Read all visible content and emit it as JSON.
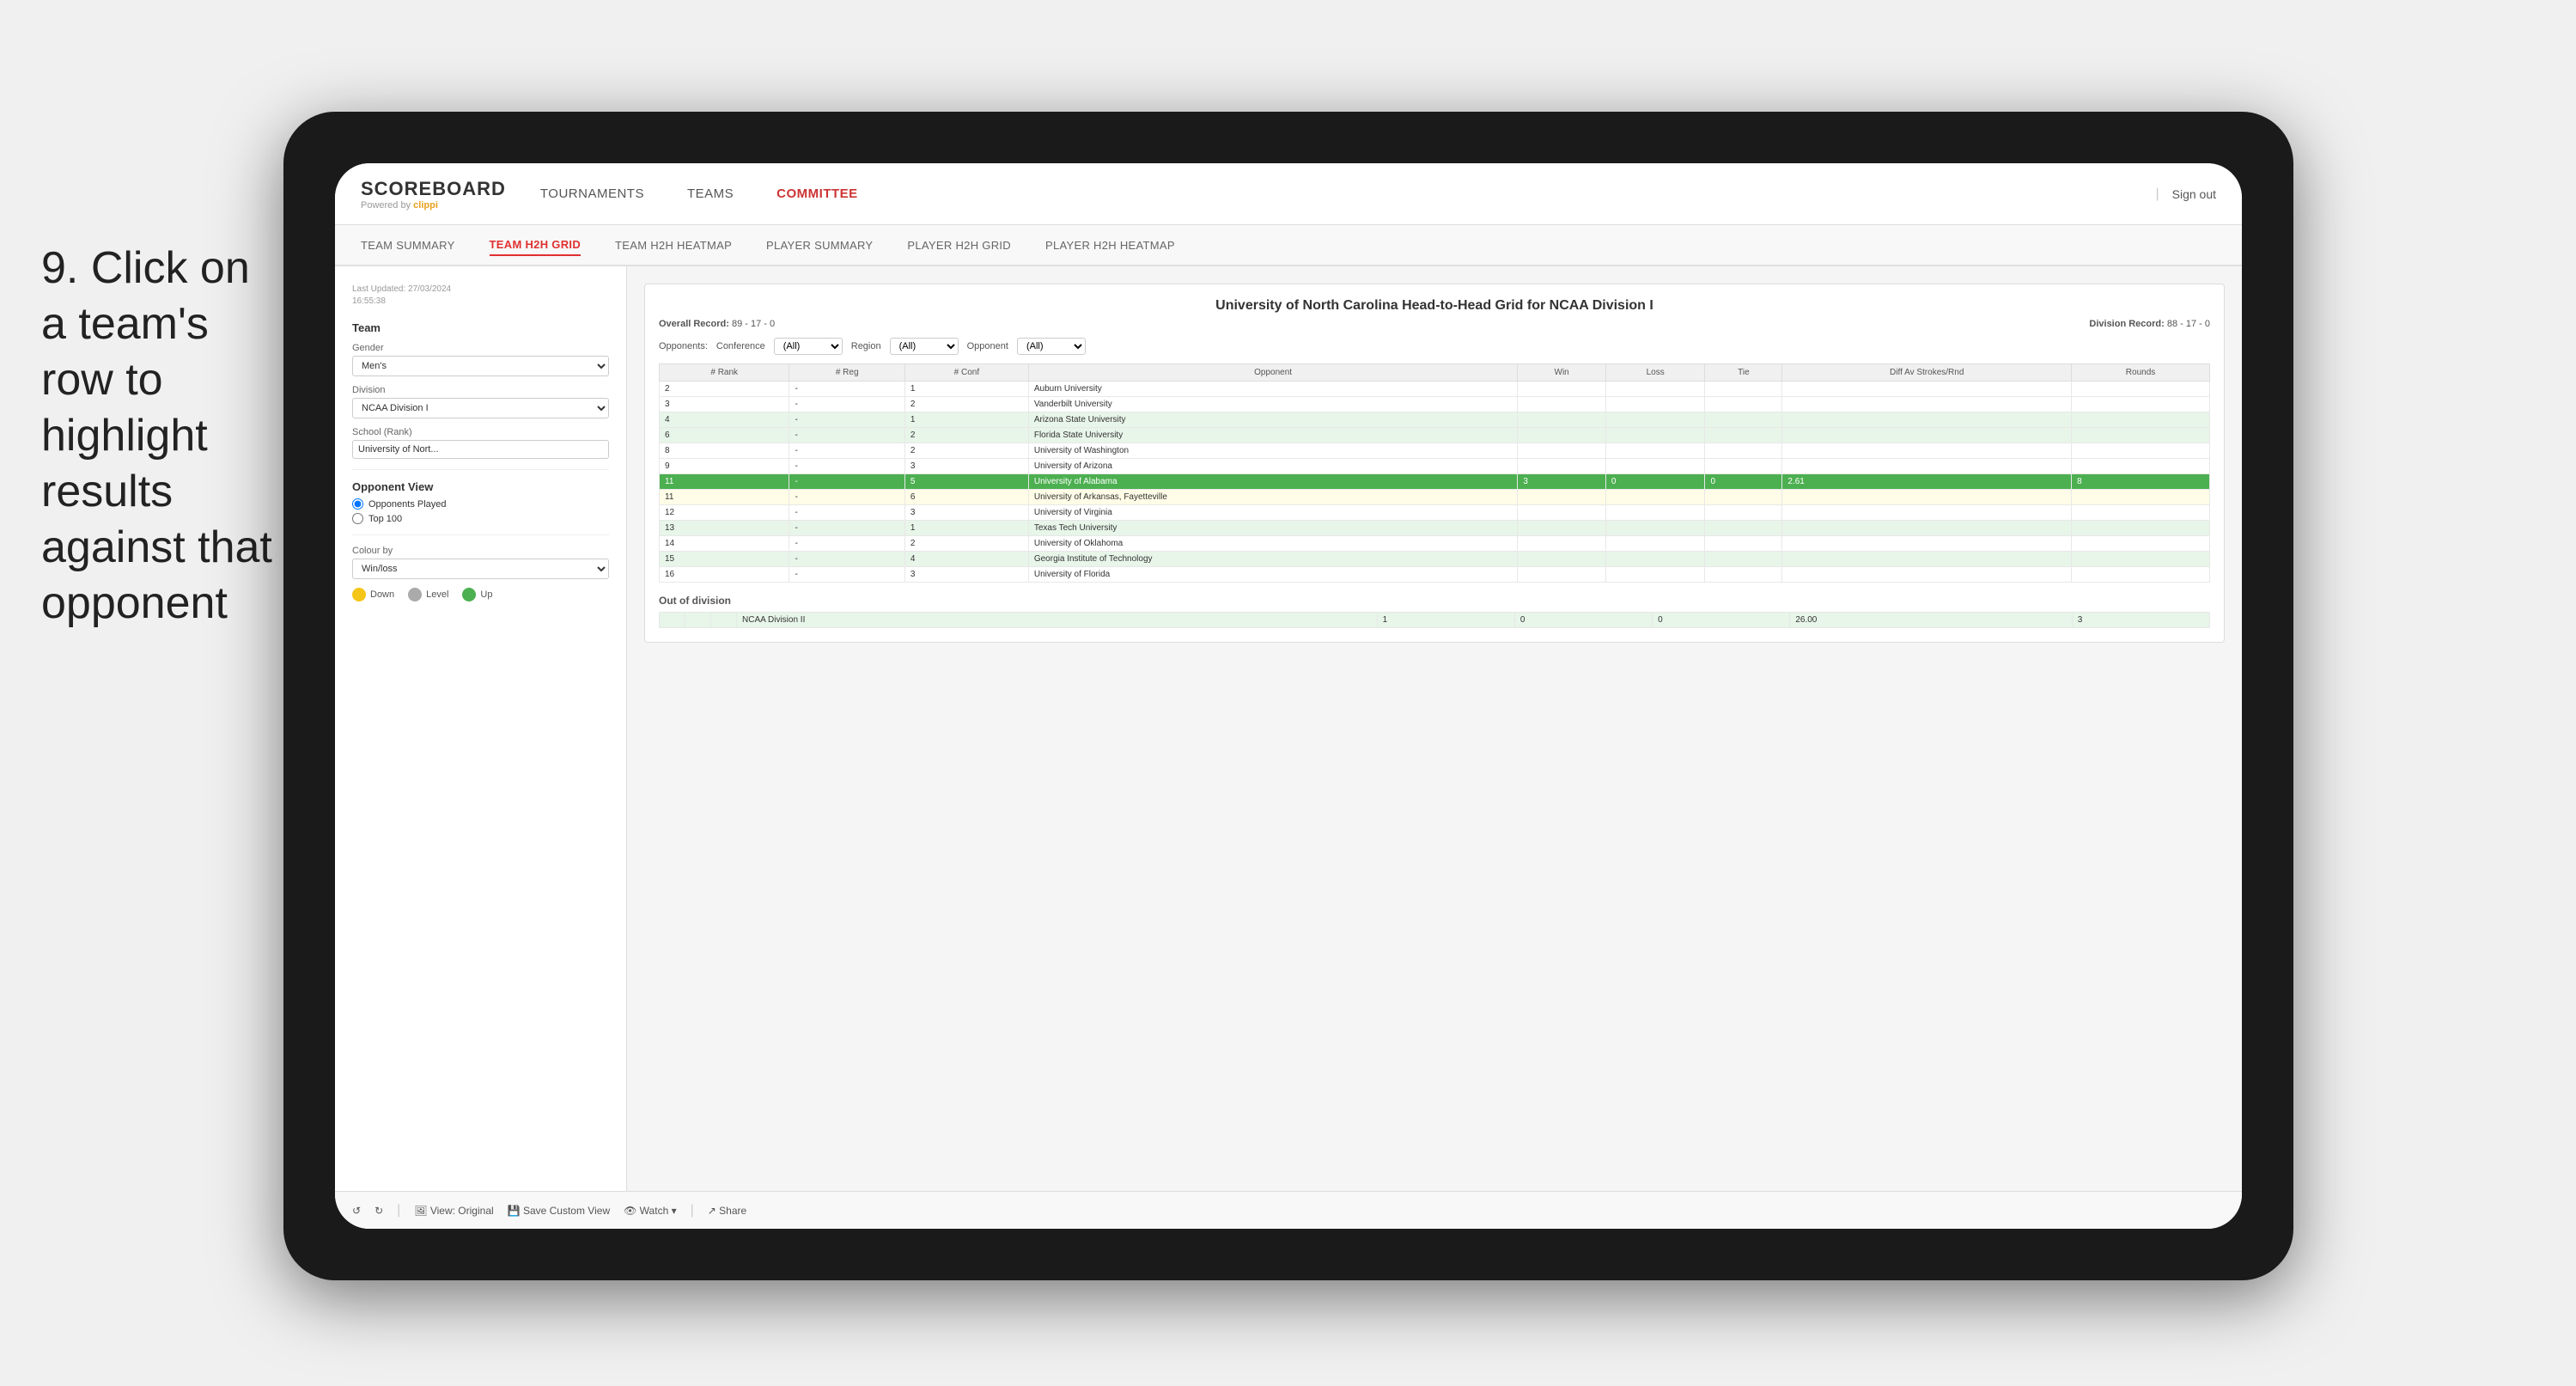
{
  "instruction": {
    "number": "9.",
    "text": "Click on a team's row to highlight results against that opponent"
  },
  "nav": {
    "logo": "SCOREBOARD",
    "powered_by": "Powered by",
    "brand": "clippi",
    "items": [
      "TOURNAMENTS",
      "TEAMS",
      "COMMITTEE"
    ],
    "sign_out": "Sign out"
  },
  "sub_nav": {
    "items": [
      "TEAM SUMMARY",
      "TEAM H2H GRID",
      "TEAM H2H HEATMAP",
      "PLAYER SUMMARY",
      "PLAYER H2H GRID",
      "PLAYER H2H HEATMAP"
    ],
    "active": "TEAM H2H GRID"
  },
  "left_panel": {
    "last_updated_label": "Last Updated: 27/03/2024",
    "last_updated_time": "16:55:38",
    "team_label": "Team",
    "gender_label": "Gender",
    "gender_value": "Men's",
    "division_label": "Division",
    "division_value": "NCAA Division I",
    "school_label": "School (Rank)",
    "school_value": "University of Nort...",
    "opponent_view_label": "Opponent View",
    "radio_options": [
      "Opponents Played",
      "Top 100"
    ],
    "radio_selected": "Opponents Played",
    "colour_by_label": "Colour by",
    "colour_by_value": "Win/loss",
    "legend": [
      {
        "label": "Down",
        "color": "#f5c518"
      },
      {
        "label": "Level",
        "color": "#aaaaaa"
      },
      {
        "label": "Up",
        "color": "#4caf50"
      }
    ]
  },
  "grid": {
    "title": "University of North Carolina Head-to-Head Grid for NCAA Division I",
    "overall_record_label": "Overall Record:",
    "overall_record": "89 - 17 - 0",
    "division_record_label": "Division Record:",
    "division_record": "88 - 17 - 0",
    "filters": {
      "opponents_label": "Opponents:",
      "conference_label": "Conference",
      "conference_value": "(All)",
      "region_label": "Region",
      "region_value": "(All)",
      "opponent_label": "Opponent",
      "opponent_value": "(All)"
    },
    "columns": [
      "# Rank",
      "# Reg",
      "# Conf",
      "Opponent",
      "Win",
      "Loss",
      "Tie",
      "Diff Av Strokes/Rnd",
      "Rounds"
    ],
    "rows": [
      {
        "rank": "2",
        "reg": "-",
        "conf": "1",
        "opponent": "Auburn University",
        "win": "",
        "loss": "",
        "tie": "",
        "diff": "",
        "rounds": "",
        "style": "normal"
      },
      {
        "rank": "3",
        "reg": "-",
        "conf": "2",
        "opponent": "Vanderbilt University",
        "win": "",
        "loss": "",
        "tie": "",
        "diff": "",
        "rounds": "",
        "style": "normal"
      },
      {
        "rank": "4",
        "reg": "-",
        "conf": "1",
        "opponent": "Arizona State University",
        "win": "",
        "loss": "",
        "tie": "",
        "diff": "",
        "rounds": "",
        "style": "light-green"
      },
      {
        "rank": "6",
        "reg": "-",
        "conf": "2",
        "opponent": "Florida State University",
        "win": "",
        "loss": "",
        "tie": "",
        "diff": "",
        "rounds": "",
        "style": "light-green"
      },
      {
        "rank": "8",
        "reg": "-",
        "conf": "2",
        "opponent": "University of Washington",
        "win": "",
        "loss": "",
        "tie": "",
        "diff": "",
        "rounds": "",
        "style": "normal"
      },
      {
        "rank": "9",
        "reg": "-",
        "conf": "3",
        "opponent": "University of Arizona",
        "win": "",
        "loss": "",
        "tie": "",
        "diff": "",
        "rounds": "",
        "style": "normal"
      },
      {
        "rank": "11",
        "reg": "-",
        "conf": "5",
        "opponent": "University of Alabama",
        "win": "3",
        "loss": "0",
        "tie": "0",
        "diff": "2.61",
        "rounds": "8",
        "style": "highlighted"
      },
      {
        "rank": "11",
        "reg": "-",
        "conf": "6",
        "opponent": "University of Arkansas, Fayetteville",
        "win": "",
        "loss": "",
        "tie": "",
        "diff": "",
        "rounds": "",
        "style": "light-yellow"
      },
      {
        "rank": "12",
        "reg": "-",
        "conf": "3",
        "opponent": "University of Virginia",
        "win": "",
        "loss": "",
        "tie": "",
        "diff": "",
        "rounds": "",
        "style": "normal"
      },
      {
        "rank": "13",
        "reg": "-",
        "conf": "1",
        "opponent": "Texas Tech University",
        "win": "",
        "loss": "",
        "tie": "",
        "diff": "",
        "rounds": "",
        "style": "light-green"
      },
      {
        "rank": "14",
        "reg": "-",
        "conf": "2",
        "opponent": "University of Oklahoma",
        "win": "",
        "loss": "",
        "tie": "",
        "diff": "",
        "rounds": "",
        "style": "normal"
      },
      {
        "rank": "15",
        "reg": "-",
        "conf": "4",
        "opponent": "Georgia Institute of Technology",
        "win": "",
        "loss": "",
        "tie": "",
        "diff": "",
        "rounds": "",
        "style": "light-green"
      },
      {
        "rank": "16",
        "reg": "-",
        "conf": "3",
        "opponent": "University of Florida",
        "win": "",
        "loss": "",
        "tie": "",
        "diff": "",
        "rounds": "",
        "style": "normal"
      }
    ],
    "out_of_division_label": "Out of division",
    "out_of_division_row": {
      "division": "NCAA Division II",
      "win": "1",
      "loss": "0",
      "tie": "0",
      "diff": "26.00",
      "rounds": "3"
    }
  },
  "toolbar": {
    "buttons": [
      "View: Original",
      "Save Custom View",
      "Watch ▾",
      "Share"
    ]
  }
}
